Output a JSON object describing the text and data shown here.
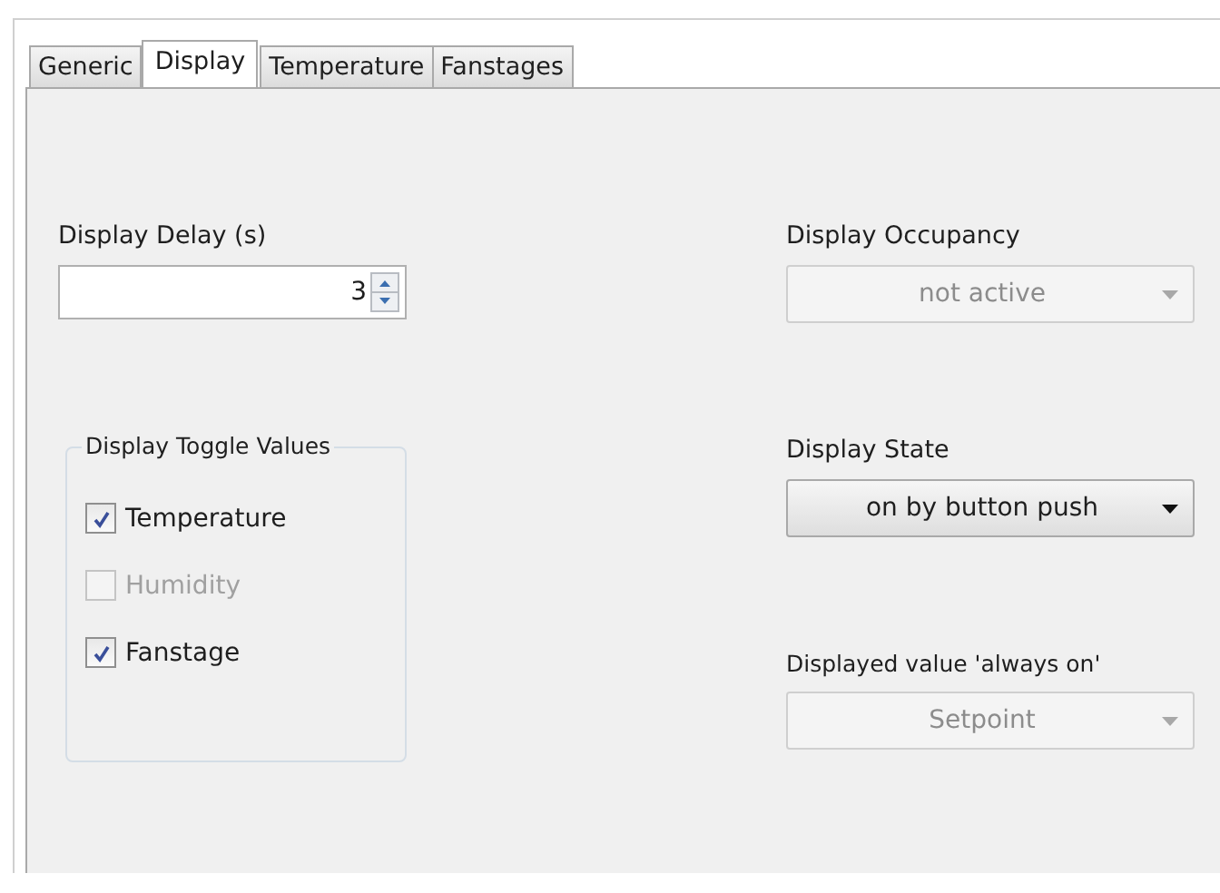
{
  "tabs": [
    {
      "label": "Generic",
      "selected": false
    },
    {
      "label": "Display",
      "selected": true
    },
    {
      "label": "Temperature",
      "selected": false
    },
    {
      "label": "Fanstages",
      "selected": false
    }
  ],
  "display_delay": {
    "label": "Display Delay (s)",
    "value": "3"
  },
  "toggle_group": {
    "title": "Display Toggle Values",
    "items": [
      {
        "label": "Temperature",
        "checked": true,
        "disabled": false
      },
      {
        "label": "Humidity",
        "checked": false,
        "disabled": true
      },
      {
        "label": "Fanstage",
        "checked": true,
        "disabled": false
      }
    ]
  },
  "dropdowns": [
    {
      "label": "Display Occupancy",
      "value": "not active",
      "disabled": true
    },
    {
      "label": "Display State",
      "value": "on by button push",
      "disabled": false
    },
    {
      "label": "Displayed value 'always on'",
      "value": "Setpoint",
      "disabled": true
    }
  ]
}
